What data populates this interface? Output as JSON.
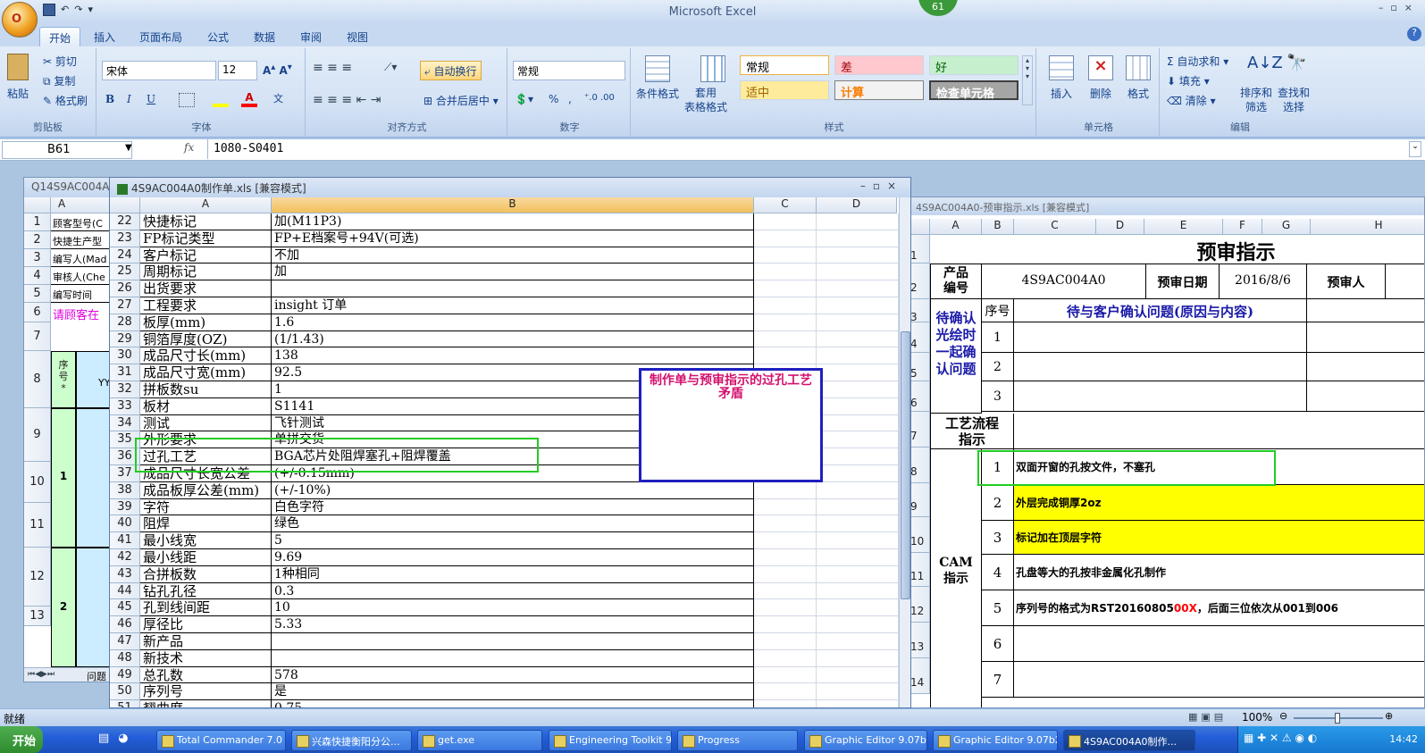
{
  "app": {
    "title": "Microsoft Excel",
    "office_button_text": "O",
    "badge": "61"
  },
  "tabs": [
    "开始",
    "插入",
    "页面布局",
    "公式",
    "数据",
    "审阅",
    "视图"
  ],
  "ribbon": {
    "clipboard": {
      "paste": "粘贴",
      "cut": "剪切",
      "copy": "复制",
      "format_painter": "格式刷",
      "label": "剪贴板"
    },
    "font": {
      "name": "宋体",
      "size": "12",
      "label": "字体",
      "bold": "B",
      "italic": "I",
      "underline": "U"
    },
    "alignment": {
      "wrap": "自动换行",
      "merge": "合并后居中",
      "label": "对齐方式"
    },
    "number": {
      "format": "常规",
      "percent": "%",
      "comma": ",",
      "label": "数字"
    },
    "styles": {
      "cond": "条件格式",
      "table": "套用\n表格格式",
      "normal": "常规",
      "bad": "差",
      "good": "好",
      "neutral": "适中",
      "calc": "计算",
      "check": "检查单元格",
      "label": "样式"
    },
    "cells": {
      "insert": "插入",
      "delete": "删除",
      "format": "格式",
      "label": "单元格"
    },
    "editing": {
      "autosum": "自动求和",
      "fill": "填充",
      "clear": "清除",
      "sort": "排序和\n筛选",
      "find": "查找和\n选择",
      "label": "编辑"
    }
  },
  "formula_bar": {
    "cell_ref": "B61",
    "fx": "fx",
    "content": "1080-S0401"
  },
  "left_window": {
    "title": "Q14S9AC004A0",
    "rows": [
      "1",
      "2",
      "3",
      "4",
      "5",
      "6",
      "7",
      "8",
      "9",
      "10",
      "11",
      "12",
      "13"
    ],
    "col_a": "A",
    "texts": [
      "顾客型号(C",
      "快捷生产型",
      "编写人(Mad",
      "审核人(Che",
      "编写时间",
      "请顾客在"
    ],
    "seq_header": "序\n号\n*",
    "seq_values": [
      "1",
      "2"
    ],
    "yy": "YY",
    "sheet_tab": "问题"
  },
  "mid_window": {
    "title": "4S9AC004A0制作单.xls  [兼容模式]",
    "columns": [
      "A",
      "B",
      "C",
      "D"
    ],
    "rows": [
      {
        "n": "22",
        "a": "快捷标记",
        "b": "加(M11P3)"
      },
      {
        "n": "23",
        "a": "FP标记类型",
        "b": "FP+E档案号+94V(可选)"
      },
      {
        "n": "24",
        "a": "客户标记",
        "b": "不加"
      },
      {
        "n": "25",
        "a": "周期标记",
        "b": "加"
      },
      {
        "n": "26",
        "a": "出货要求",
        "b": ""
      },
      {
        "n": "27",
        "a": "工程要求",
        "b": "insight 订单"
      },
      {
        "n": "28",
        "a": "板厚(mm)",
        "b": "1.6"
      },
      {
        "n": "29",
        "a": "铜箔厚度(OZ)",
        "b": " (1/1.43)"
      },
      {
        "n": "30",
        "a": "成品尺寸长(mm)",
        "b": "138"
      },
      {
        "n": "31",
        "a": "成品尺寸宽(mm)",
        "b": "92.5"
      },
      {
        "n": "32",
        "a": "拼板数su",
        "b": "1"
      },
      {
        "n": "33",
        "a": "板材",
        "b": "S1141"
      },
      {
        "n": "34",
        "a": "测试",
        "b": "飞针测试"
      },
      {
        "n": "35",
        "a": "外形要求",
        "b": "单拼交货"
      },
      {
        "n": "36",
        "a": "过孔工艺",
        "b": "BGA芯片处阻焊塞孔+阻焊覆盖"
      },
      {
        "n": "37",
        "a": "成品尺寸长宽公差",
        "b": "(+/-0.15mm)"
      },
      {
        "n": "38",
        "a": "成品板厚公差(mm)",
        "b": "(+/-10%)"
      },
      {
        "n": "39",
        "a": "字符",
        "b": "白色字符"
      },
      {
        "n": "40",
        "a": "阻焊",
        "b": "绿色"
      },
      {
        "n": "41",
        "a": "最小线宽",
        "b": "5"
      },
      {
        "n": "42",
        "a": "最小线距",
        "b": "9.69"
      },
      {
        "n": "43",
        "a": "合拼板数",
        "b": "1种相同"
      },
      {
        "n": "44",
        "a": "钻孔孔径",
        "b": "0.3"
      },
      {
        "n": "45",
        "a": "孔到线间距",
        "b": "10"
      },
      {
        "n": "46",
        "a": "厚径比",
        "b": "5.33"
      },
      {
        "n": "47",
        "a": "新产品",
        "b": ""
      },
      {
        "n": "48",
        "a": "新技术",
        "b": ""
      },
      {
        "n": "49",
        "a": "总孔数",
        "b": "578"
      },
      {
        "n": "50",
        "a": "序列号",
        "b": "是"
      },
      {
        "n": "51",
        "a": "翘曲度",
        "b": "0.75"
      }
    ]
  },
  "annotation": {
    "text": "制作单与预审指示的过孔工艺矛盾"
  },
  "right_window": {
    "title": "4S9AC004A0-预审指示.xls  [兼容模式]",
    "columns": [
      "A",
      "B",
      "C",
      "D",
      "E",
      "F",
      "G",
      "H"
    ],
    "rows": [
      "1",
      "2",
      "3",
      "4",
      "5",
      "6",
      "7",
      "8",
      "9",
      "10",
      "11",
      "12",
      "13",
      "14"
    ],
    "heading": "预审指示",
    "product_label": "产品\n编号",
    "product_no": "4S9AC004A0",
    "date_label": "预审日期",
    "date": "2016/8/6",
    "reviewer_label": "预审人",
    "seq_label": "序号",
    "pending_header": "待与客户确认问题(原因与内容)",
    "pending_label": "待确认\n光绘时\n一起确\n认问题",
    "pending_nums": [
      "1",
      "2",
      "3"
    ],
    "flow_label": "工艺流程\n指示",
    "cam_label": "CAM\n指示",
    "cam_items": [
      {
        "n": "1",
        "text": "双面开窗的孔按文件，不塞孔"
      },
      {
        "n": "2",
        "text": "外层完成铜厚2oz"
      },
      {
        "n": "3",
        "text": "标记加在顶层字符"
      },
      {
        "n": "4",
        "text": "孔盘等大的孔按非金属化孔制作"
      },
      {
        "n": "5",
        "text_a": "序列号的格式为RST20160805",
        "text_red": "00X",
        "text_b": "，后面三位依次从001到006"
      },
      {
        "n": "6",
        "text": ""
      },
      {
        "n": "7",
        "text": ""
      }
    ]
  },
  "status": {
    "ready": "就绪",
    "zoom": "100%"
  },
  "taskbar": {
    "start": "开始",
    "items": [
      "Total Commander 7.0 ...",
      "兴森快捷衡阳分公...",
      "get.exe",
      "Engineering Toolkit 9....",
      "Progress",
      "Graphic Editor 9.07b2...",
      "Graphic Editor 9.07b2...",
      "4S9AC004A0制作..."
    ],
    "clock": "14:42"
  },
  "colors": {
    "highlight_yellow": "#ffff00",
    "annotation_border": "#1f1fbf",
    "annotation_text": "#d4106c",
    "green_box": "#22cc22",
    "heading_blue": "#1a1aa8"
  }
}
